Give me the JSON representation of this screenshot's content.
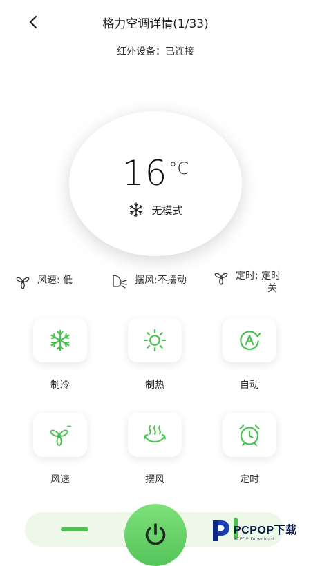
{
  "header": {
    "title": "格力空调详情(1/33)",
    "subtitle": "红外设备：已连接"
  },
  "dial": {
    "temperature": "16",
    "unit": "°C",
    "mode": "无模式"
  },
  "status": {
    "fan_speed": "风速:  低",
    "swing": "摆风:不摆动",
    "timer_line1": "定时:  定时",
    "timer_line2": "关"
  },
  "buttons": {
    "cool": "制冷",
    "heat": "制热",
    "auto": "自动",
    "fan": "风速",
    "swing": "摆风",
    "timer": "定时"
  },
  "watermark": {
    "brand": "PCPOP下载",
    "sub": "PCPOP Download"
  },
  "colors": {
    "accent": "#4cc152",
    "power_button": "#5ecb60",
    "bottom_bar": "#eef8e9"
  }
}
